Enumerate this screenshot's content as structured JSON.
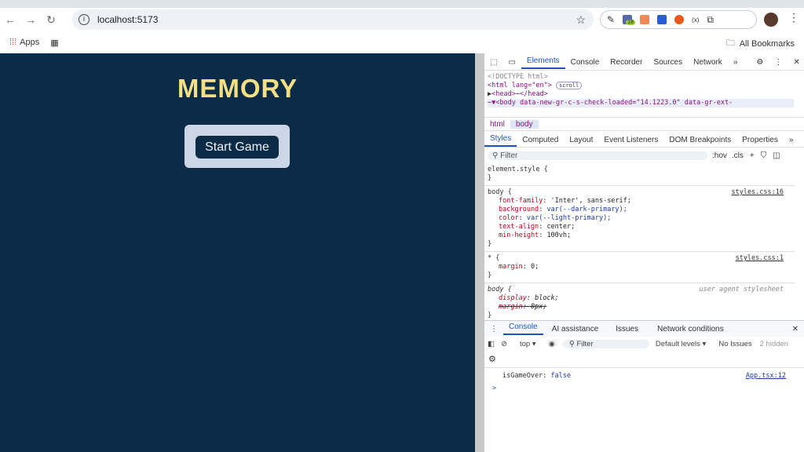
{
  "browser": {
    "url": "localhost:5173",
    "bookmarks": {
      "apps": "Apps",
      "all": "All Bookmarks"
    },
    "ext_badge": "18"
  },
  "page": {
    "title": "MEMORY",
    "start_button": "Start Game",
    "colors": {
      "bg": "#0c2b47",
      "title": "#f3df86"
    }
  },
  "devtools": {
    "tabs": [
      "Elements",
      "Console",
      "Recorder",
      "Sources",
      "Network"
    ],
    "dom": [
      "<!DOCTYPE html>",
      "<html lang=\"en\">",
      "scroll",
      "<head>",
      "</head>",
      "<body data-new-gr-c-s-check-loaded=\"14.1223.0\" data-gr-ext-"
    ],
    "breadcrumbs": [
      "html",
      "body"
    ],
    "subtabs": [
      "Styles",
      "Computed",
      "Layout",
      "Event Listeners",
      "DOM Breakpoints",
      "Properties"
    ],
    "filter_placeholder": "Filter",
    "hov": ":hov",
    "cls": ".cls",
    "rules": [
      {
        "selector": "element.style {",
        "close": "}",
        "decls": []
      },
      {
        "selector": "body {",
        "source": "styles.css:16",
        "close": "}",
        "decls": [
          [
            "font-family",
            "'Inter', sans-serif;"
          ],
          [
            "background",
            "var(--dark-primary);"
          ],
          [
            "color",
            "var(--light-primary);"
          ],
          [
            "text-align",
            "center;"
          ],
          [
            "min-height",
            "100vh;"
          ]
        ]
      },
      {
        "selector": "* {",
        "source": "styles.css:1",
        "close": "}",
        "decls": [
          [
            "margin",
            "0;"
          ]
        ]
      },
      {
        "selector": "body {",
        "source": "user agent stylesheet",
        "close": "}",
        "decls": [
          [
            "display",
            "block;"
          ],
          [
            "margin",
            "0px;"
          ]
        ]
      }
    ],
    "drawer_tabs": [
      "Console",
      "AI assistance",
      "Issues",
      "Network conditions"
    ],
    "console_toolbar": {
      "context": "top",
      "filter": "Filter",
      "levels": "Default levels",
      "issues": "No Issues",
      "hidden": "2 hidden"
    },
    "log": {
      "text": "isGameOver: ",
      "value": "false",
      "source": "App.tsx:12"
    },
    "prompt": ">"
  }
}
